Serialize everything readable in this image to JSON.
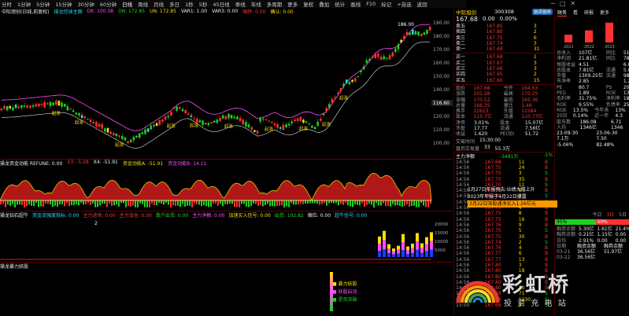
{
  "toolbar": {
    "items": [
      "分时",
      "1分钟",
      "5分钟",
      "15分钟",
      "30分钟",
      "60分钟",
      "日线",
      "周线",
      "月线",
      "多日",
      "1秒",
      "5秒",
      "45日线",
      "季线",
      "年线",
      "多周期",
      "更多"
    ],
    "tools": [
      "复权",
      "叠加",
      "统计",
      "画线",
      "F10",
      "标记",
      "+自选",
      "返回"
    ],
    "active": "日线"
  },
  "stock_header": {
    "name": "中际旭创",
    "code": "300308",
    "badge": "融资融券"
  },
  "main_info": {
    "title": "中际旭创(日线,前复权)",
    "indicator": "操龙控球主图",
    "items": [
      "DK: 100.08",
      "DN: 172.85",
      "UN: 172.85",
      "VAR1: 1.00",
      "VAR3: 0.00",
      "强转: 0.00",
      "确认: 0.00"
    ]
  },
  "price_axis": [
    "190.00",
    "180.00",
    "170.00",
    "160.00",
    "150.00",
    "140.00",
    "130.00",
    "120.00",
    "110.00",
    "100.00"
  ],
  "price_axis_main": [
    "190.00",
    "180.00",
    "170.00",
    "160.00",
    "150.00",
    "140.00",
    "130.00",
    "120.00",
    "110.00",
    "100.00"
  ],
  "price_marker": "116.60",
  "peak_label": "186.00",
  "signals": {
    "buy": [
      "起涨",
      "起涨",
      "起涨",
      "起涨",
      "起涨",
      "起涨",
      "起涨",
      "起涨",
      "起涨",
      "起涨"
    ]
  },
  "panel2": {
    "title": "操龙资金动能 REFUNE: 0.00",
    "items": [
      "X3: -5.28",
      "X4: -51.91",
      "资金动能A: -51.91",
      "资金动能B: 14.11"
    ]
  },
  "panel3": {
    "title": "操龙钻石超牛",
    "items": [
      "资金流强度指标: 0.00",
      "主力进场: 0.00",
      "主力加仓: 0.00",
      "散户出货: 0.00",
      "主力净额: 0.00",
      "加速买入信号: 0.00",
      "出货: 102.82",
      "缩位: 0.00",
      "超牛信号: 0.00"
    ],
    "label_2": "2",
    "axis": [
      "20000",
      "15000",
      "10000",
      "5000"
    ]
  },
  "panel4": {
    "title": "操龙暴力妖股",
    "legend": [
      "暴力妖股",
      "妖股启动",
      "是否突破"
    ]
  },
  "quote": {
    "price": "167.68",
    "change": "0.00",
    "pct": "0.00%",
    "sells": [
      [
        "卖五",
        "167.85",
        "3"
      ],
      [
        "卖四",
        "167.80",
        "2"
      ],
      [
        "卖三",
        "167.75",
        "6"
      ],
      [
        "卖二",
        "167.74",
        "3"
      ],
      [
        "卖一",
        "167.69",
        "31"
      ]
    ],
    "buys": [
      [
        "买一",
        "167.68",
        "1"
      ],
      [
        "买二",
        "167.67",
        "3"
      ],
      [
        "买三",
        "167.66",
        "3"
      ],
      [
        "买四",
        "167.65",
        "2"
      ],
      [
        "买五",
        "167.60",
        "15"
      ]
    ],
    "stats": [
      [
        "现价",
        "167.68",
        "今开",
        "164.63"
      ],
      [
        "涨跌",
        "201.28",
        "最高",
        "170.25"
      ],
      [
        "涨幅",
        "170.52",
        "最低",
        "165.36"
      ],
      [
        "总量",
        "166.35",
        "量比",
        "1.46"
      ],
      [
        "换手",
        "22613",
        "外盘",
        "11584"
      ],
      [
        "股本",
        "115.7亿",
        "流通",
        "110.77亿"
      ]
    ],
    "stats2": [
      [
        "净资",
        "3.01%",
        "股本",
        "15.07亿"
      ],
      [
        "市盈",
        "17.77",
        "流通",
        "7.56亿"
      ],
      [
        "收益",
        "1.620",
        "PE(动)",
        "51.72"
      ]
    ],
    "trade_time": "15:30:00",
    "summary_pair": [
      "盘后交易量",
      "33",
      "55.3万"
    ]
  },
  "flow": {
    "title": "主力净额",
    "value": "-3481万",
    "pct": "-1%",
    "rows": [
      [
        "14:56",
        "167.68",
        "11",
        "B"
      ],
      [
        "14:56",
        "167.75",
        "24",
        "B"
      ],
      [
        "14:56",
        "167.70",
        "3",
        "S"
      ],
      [
        "14:56",
        "167.75",
        "35",
        "B"
      ],
      [
        "14:56",
        "167.70",
        "11",
        "S"
      ],
      [
        "14:56",
        "167.75",
        "6",
        "B"
      ],
      [
        "14:56",
        "167.70",
        "3",
        "S"
      ],
      [
        "14:56",
        "167.70",
        "300",
        "S"
      ],
      [
        "14:56",
        "167.75",
        "4",
        "B"
      ],
      [
        "14:56",
        "167.75",
        "8",
        "B"
      ],
      [
        "14:56",
        "167.75",
        "16",
        "B"
      ],
      [
        "14:56",
        "167.76",
        "9",
        "B"
      ],
      [
        "14:56",
        "167.70",
        "5",
        "S"
      ],
      [
        "14:56",
        "167.75",
        "30",
        "B"
      ],
      [
        "14:56",
        "167.74",
        "2",
        "S"
      ],
      [
        "14:56",
        "167.76",
        "4",
        "B"
      ],
      [
        "14:56",
        "167.77",
        "6",
        "B"
      ],
      [
        "14:56",
        "167.77",
        "13",
        "B"
      ],
      [
        "14:56",
        "167.80",
        "3",
        "B"
      ],
      [
        "14:56",
        "167.80",
        "18",
        "B"
      ],
      [
        "14:56",
        "167.80",
        "2",
        "B"
      ],
      [
        "14:56",
        "167.80",
        "7",
        "B"
      ],
      [
        "14:59",
        "167.80",
        "10",
        "B"
      ],
      [
        "14:59",
        "167.68",
        "71",
        "S"
      ],
      [
        "15:00",
        "167.68",
        "1230",
        "S"
      ],
      [
        "15:00",
        "167.68",
        "3",
        "S"
      ]
    ]
  },
  "news": [
    "1月27日年报预告:业绩大幅上升",
    "2023年年报于4月22日披露",
    "3月22日深股通净买入1.26亿元"
  ],
  "far": {
    "tabs": [
      "财务",
      "看",
      "研报",
      "更多"
    ],
    "bars": [
      {
        "year": "2021",
        "v": 0.35
      },
      {
        "year": "2022",
        "v": 0.55
      },
      {
        "year": "2023",
        "v": 0.9
      }
    ],
    "metrics": [
      [
        "总收入",
        "107亿",
        "同比",
        "51.5%"
      ],
      [
        "净利润",
        "21.81亿",
        "同比",
        "78.16"
      ],
      [
        "每股收益",
        "4.51",
        "",
        "6.83"
      ],
      [
        "总股本",
        "7.81亿",
        "流通",
        "5.85"
      ],
      [
        "市值",
        "1309.25亿",
        "流通",
        "982.61"
      ],
      [
        "市净率",
        "2.85",
        "",
        "1.2"
      ],
      [
        "PE",
        "80.7",
        "PS",
        "20.12"
      ],
      [
        "PEG",
        "1.89",
        "ROE",
        "13%"
      ],
      [
        "毛利率",
        "31.75%",
        "净利率",
        "18.7%"
      ],
      [
        "ROE",
        "9.55%",
        "负债率",
        "25.1%"
      ]
    ],
    "roe_row": [
      [
        "ROE",
        "13.5%",
        "今年来",
        "13%"
      ],
      [
        "20日",
        "0.14%",
        "近一年",
        "4.3"
      ]
    ],
    "holders": [
      [
        "股东数",
        "186.08",
        "",
        "6.71"
      ],
      [
        "人均",
        "1346亿",
        "",
        "1346"
      ]
    ],
    "dates": [
      [
        "23-09-30",
        "",
        "23-06-30"
      ],
      [
        "7.1万",
        "",
        "7.50"
      ],
      [
        "-5.06%",
        "",
        "82.48%"
      ]
    ],
    "hk": [
      "今日",
      "3日",
      "5日"
    ],
    "hk_on": "3日",
    "margin": [
      [
        "融资余额",
        "5.30亿",
        "1.61亿",
        "21.4%"
      ],
      [
        "融券余额",
        "0.21亿",
        "1.15亿",
        "0.00"
      ],
      [
        "日均",
        "2.91%",
        "0.00",
        "0.00"
      ]
    ],
    "margin_head": [
      "日期",
      "融资余额",
      "融券余额"
    ],
    "margin_rows": [
      [
        "03-21",
        "36.56亿",
        "51.97亿"
      ],
      [
        "03-22",
        "36.56亿",
        ""
      ]
    ],
    "bar_tags": [
      "95%",
      "50%"
    ]
  },
  "watermark": {
    "text_cn": "彩虹桥",
    "text_sub": "投 资 充 电 站"
  }
}
